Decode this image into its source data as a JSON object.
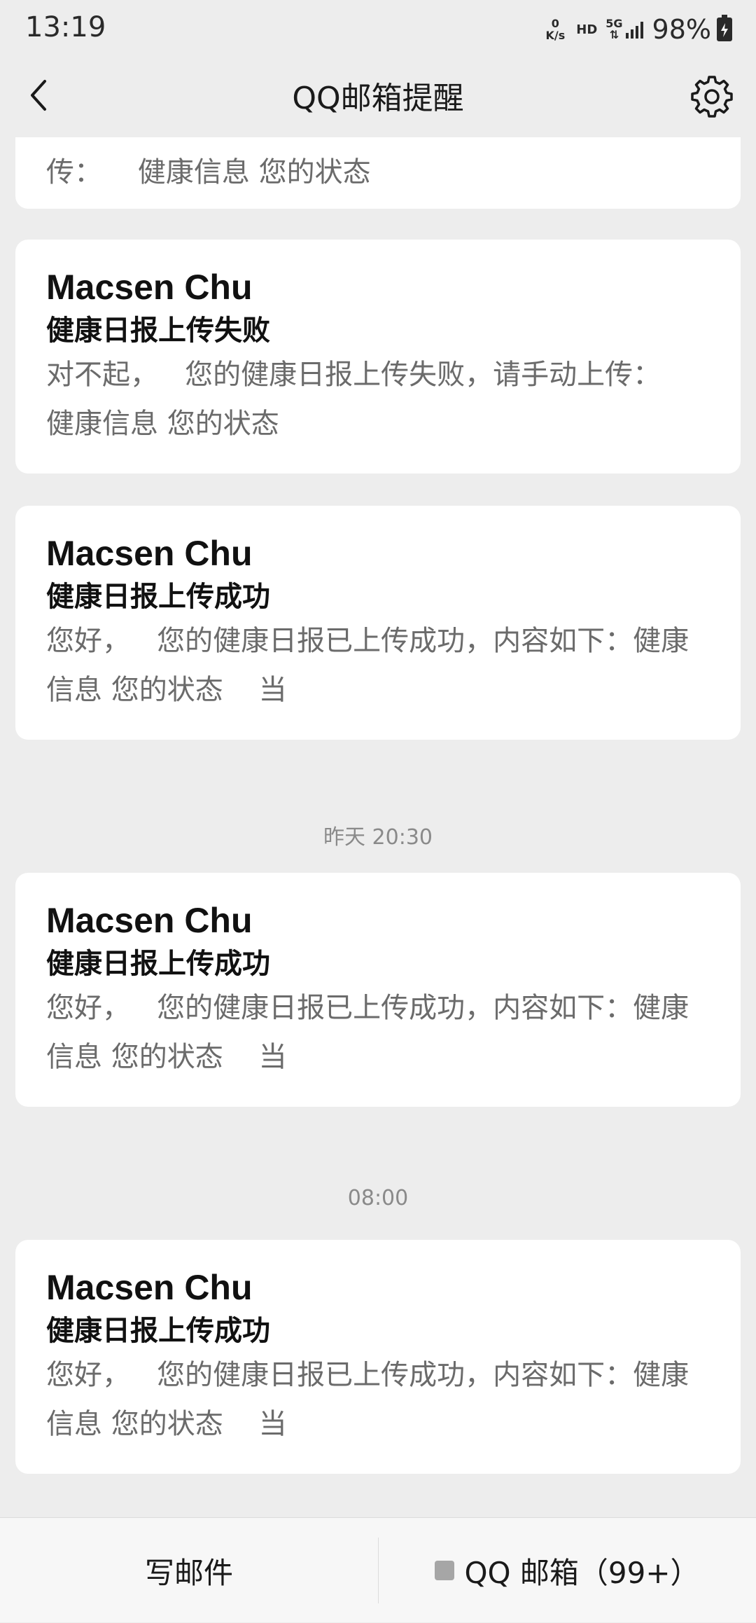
{
  "status_bar": {
    "time": "13:19",
    "net_speed_value": "0",
    "net_speed_unit": "K/s",
    "hd_label": "HD",
    "network_type": "5G",
    "network_arrows": "⇅",
    "battery_percent": "98%",
    "icons": [
      "signal-icon",
      "battery-charging-icon"
    ]
  },
  "header": {
    "title": "QQ邮箱提醒",
    "back_icon": "chevron-left-icon",
    "settings_icon": "gear-icon"
  },
  "messages": {
    "partial_top": {
      "preview_tail": "传：    健康信息 您的状态"
    },
    "items": [
      {
        "sender": "Macsen Chu",
        "subject": "健康日报上传失败",
        "preview": "对不起，   您的健康日报上传失败，请手动上传：    健康信息 您的状态"
      },
      {
        "sender": "Macsen Chu",
        "subject": "健康日报上传成功",
        "preview": "您好，   您的健康日报已上传成功，内容如下：健康信息 您的状态    当"
      },
      {
        "sender": "Macsen Chu",
        "subject": "健康日报上传成功",
        "preview": "您好，   您的健康日报已上传成功，内容如下：健康信息 您的状态    当"
      },
      {
        "sender": "Macsen Chu",
        "subject": "健康日报上传成功",
        "preview": "您好，   您的健康日报已上传成功，内容如下：健康信息 您的状态    当"
      }
    ],
    "timestamps": [
      "昨天 20:30",
      "08:00"
    ]
  },
  "bottom_bar": {
    "compose_label": "写邮件",
    "mailbox_label": "QQ 邮箱（99+）",
    "mailbox_icon": "menu-square-icon"
  }
}
